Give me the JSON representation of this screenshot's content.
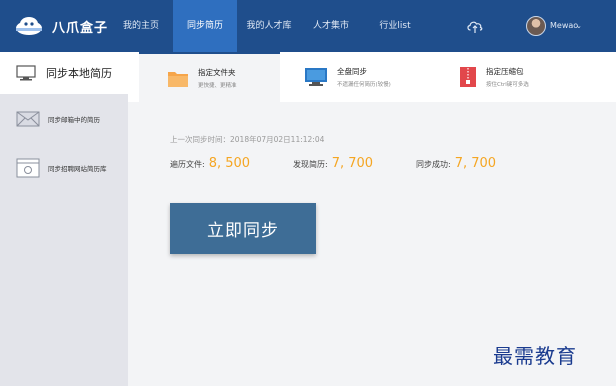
{
  "app": {
    "brand": "八爪盒子"
  },
  "nav": {
    "items": [
      {
        "label": "我的主页",
        "active": false
      },
      {
        "label": "同步简历",
        "active": true
      },
      {
        "label": "我的人才库",
        "active": false
      },
      {
        "label": "人才集市",
        "active": false
      },
      {
        "label": "行业list",
        "active": false
      }
    ],
    "cloud_icon": "cloud-upload-icon",
    "username": "Mewao",
    "caret": "⌄"
  },
  "sidebar": {
    "header": "同步本地简历",
    "items": [
      {
        "label": "同步邮箱中的简历",
        "icon": "envelope-icon"
      },
      {
        "label": "同步招聘网站简历库",
        "icon": "browser-icon"
      }
    ]
  },
  "tabs": [
    {
      "title": "指定文件夹",
      "subtitle": "更快捷、更精准",
      "icon": "folder-icon",
      "active": true
    },
    {
      "title": "全盘同步",
      "subtitle": "不遗漏任何简历(较慢)",
      "icon": "monitor-icon",
      "active": false
    },
    {
      "title": "指定压缩包",
      "subtitle": "按住Ctrl键可多选",
      "icon": "zip-file-icon",
      "active": false
    }
  ],
  "sync": {
    "last_sync_label": "上一次同步时间：",
    "last_sync_time": "2018年07月02日11:12:04",
    "stats": [
      {
        "label": "遍历文件:",
        "value": "8, 500"
      },
      {
        "label": "发现简历:",
        "value": "7, 700"
      },
      {
        "label": "同步成功:",
        "value": "7, 700"
      }
    ],
    "button_label": "立即同步"
  },
  "watermark": "最需教育",
  "colors": {
    "nav_bg": "#1f4e8c",
    "nav_active": "#2f6fbf",
    "sidebar_bg": "#e3e4ea",
    "main_bg": "#f3f4f6",
    "accent_orange": "#f5a623",
    "button_bg": "#3e6d96",
    "watermark": "#1a3b8f"
  }
}
